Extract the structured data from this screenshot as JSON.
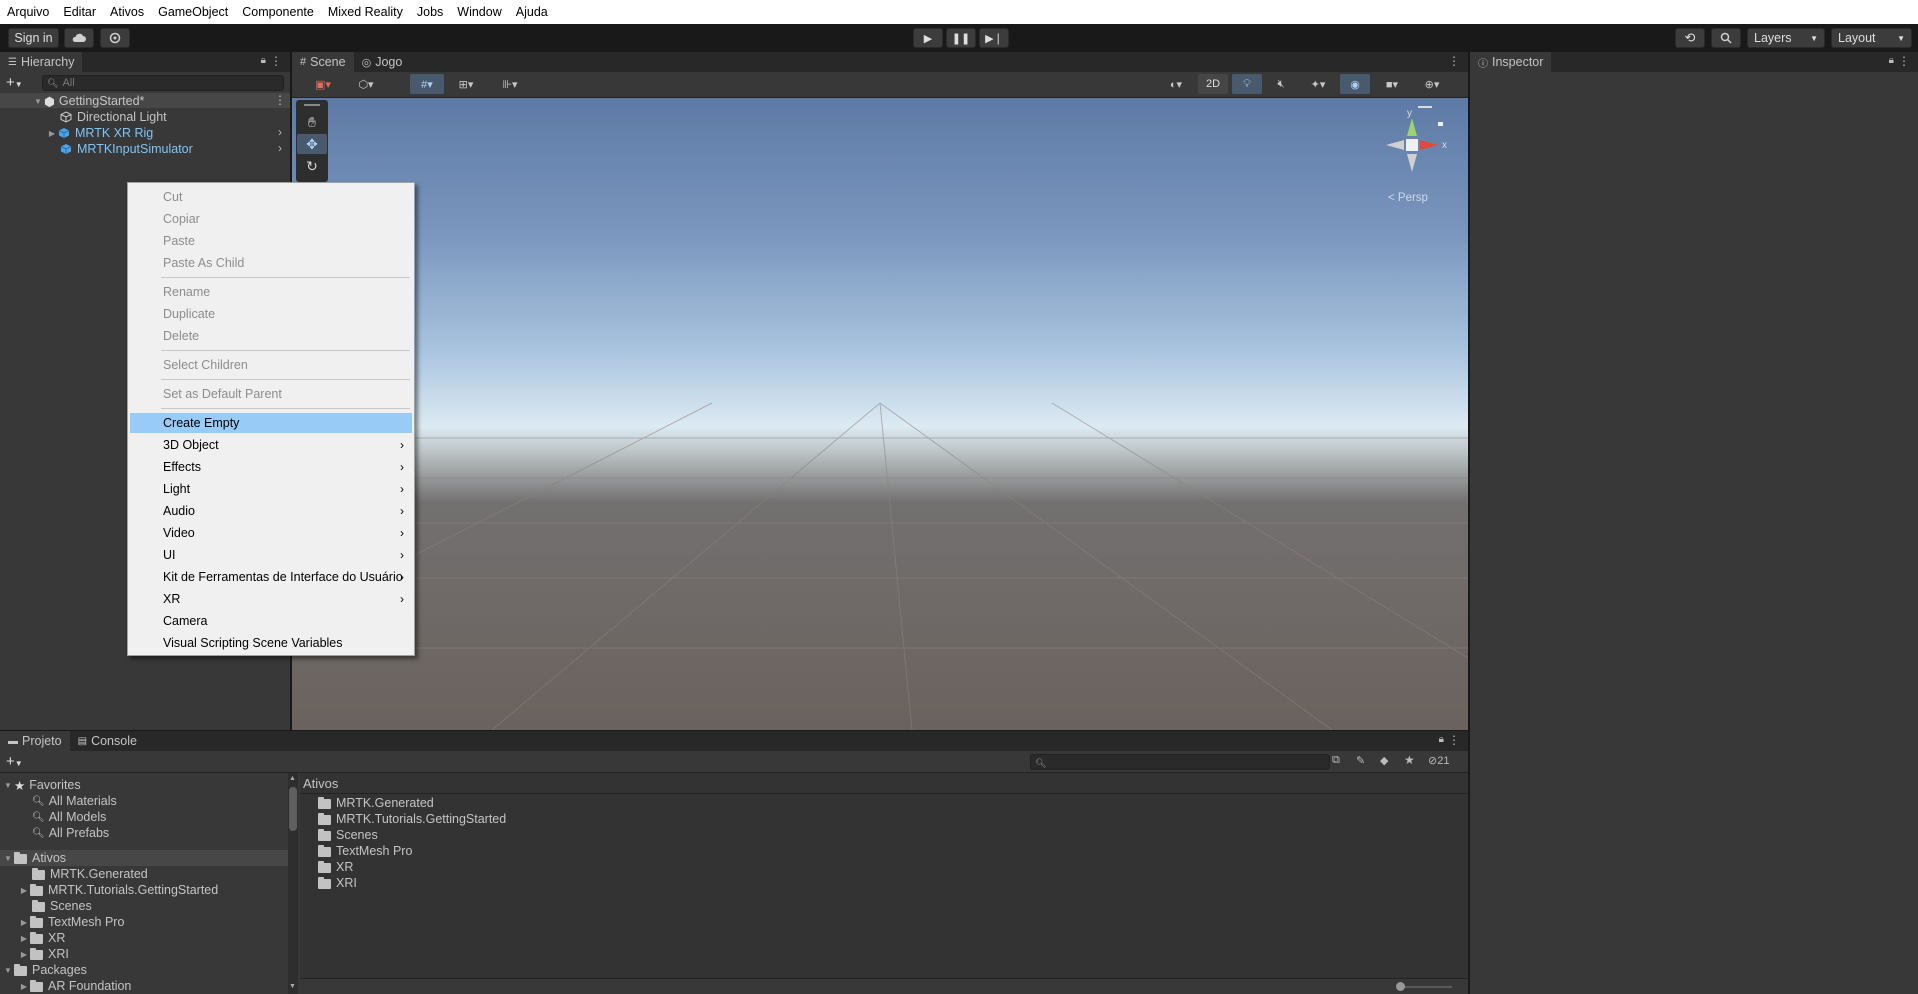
{
  "menu": [
    "Arquivo",
    "Editar",
    "Ativos",
    "GameObject",
    "Componente",
    "Mixed Reality",
    "Jobs",
    "Window",
    "Ajuda"
  ],
  "toolbar": {
    "sign_in": "Sign in",
    "layers": "Layers",
    "layout": "Layout"
  },
  "hierarchy": {
    "tab": "Hierarchy",
    "search_placeholder": "All",
    "scene": "GettingStarted*",
    "items": [
      "Directional Light",
      "MRTK XR Rig",
      "MRTKInputSimulator"
    ]
  },
  "scene_view": {
    "tab_scene": "Scene",
    "tab_game": "Jogo",
    "btn_2d": "2D",
    "persp": "< Persp",
    "gizmo_y": "y",
    "gizmo_x": "x"
  },
  "inspector": {
    "tab": "Inspector"
  },
  "context_menu": {
    "group1": [
      "Cut",
      "Copiar",
      "Paste",
      "Paste As Child"
    ],
    "group2": [
      "Rename",
      "Duplicate",
      "Delete"
    ],
    "group3": [
      "Select Children"
    ],
    "group4": [
      "Set as Default Parent"
    ],
    "group5": [
      "Create Empty",
      "3D Object",
      "Effects",
      "Light",
      "Audio",
      "Video",
      "UI",
      "Kit de Ferramentas de Interface do Usuário",
      "XR",
      "Camera",
      "Visual Scripting Scene Variables"
    ]
  },
  "project": {
    "tab_project": "Projeto",
    "tab_console": "Console",
    "favorites": "Favorites",
    "fav_items": [
      "All Materials",
      "All Models",
      "All Prefabs"
    ],
    "assets": "Ativos",
    "asset_folders": [
      "MRTK.Generated",
      "MRTK.Tutorials.GettingStarted",
      "Scenes",
      "TextMesh Pro",
      "XR",
      "XRI"
    ],
    "packages": "Packages",
    "package_first": "AR Foundation",
    "breadcrumb": "Ativos",
    "hidden_count": "21"
  }
}
